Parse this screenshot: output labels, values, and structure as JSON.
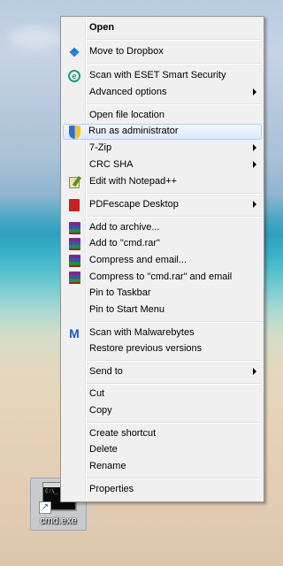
{
  "desktop": {
    "icon_label": "cmd.exe",
    "cmd_preview_text": "C:\\_"
  },
  "menu": {
    "items": [
      {
        "label": "Open",
        "bold": true
      },
      {
        "label": "Move to Dropbox",
        "icon": "dropbox-icon"
      },
      {
        "label": "Scan with ESET Smart Security",
        "icon": "eset-icon"
      },
      {
        "label": "Advanced options",
        "submenu": true
      },
      {
        "label": "Open file location"
      },
      {
        "label": "Run as administrator",
        "icon": "uac-shield-icon",
        "highlighted": true
      },
      {
        "label": "7-Zip",
        "submenu": true
      },
      {
        "label": "CRC SHA",
        "submenu": true
      },
      {
        "label": "Edit with Notepad++",
        "icon": "notepad-plus-plus-icon"
      },
      {
        "label": "PDFescape Desktop",
        "icon": "pdfescape-icon",
        "submenu": true
      },
      {
        "label": "Add to archive...",
        "icon": "winrar-icon"
      },
      {
        "label": "Add to \"cmd.rar\"",
        "icon": "winrar-icon"
      },
      {
        "label": "Compress and email...",
        "icon": "winrar-icon"
      },
      {
        "label": "Compress to \"cmd.rar\" and email",
        "icon": "winrar-icon"
      },
      {
        "label": "Pin to Taskbar"
      },
      {
        "label": "Pin to Start Menu"
      },
      {
        "label": "Scan with Malwarebytes",
        "icon": "malwarebytes-icon"
      },
      {
        "label": "Restore previous versions"
      },
      {
        "label": "Send to",
        "submenu": true
      },
      {
        "label": "Cut"
      },
      {
        "label": "Copy"
      },
      {
        "label": "Create shortcut"
      },
      {
        "label": "Delete"
      },
      {
        "label": "Rename"
      },
      {
        "label": "Properties"
      }
    ]
  },
  "colors": {
    "menu_bg": "#f0f0f0",
    "highlight_border": "#aecff7",
    "highlight_fill": "#dfeaf8"
  }
}
